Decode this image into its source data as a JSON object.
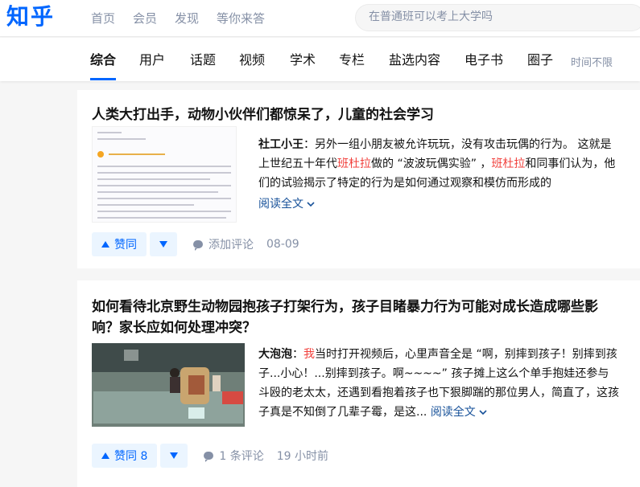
{
  "header": {
    "logo": "知乎",
    "nav": [
      "首页",
      "会员",
      "发现",
      "等你来答"
    ],
    "search_placeholder": "在普通班可以考上大学吗"
  },
  "tabs": {
    "items": [
      "综合",
      "用户",
      "话题",
      "视频",
      "学术",
      "专栏",
      "盐选内容",
      "电子书",
      "圈子"
    ],
    "active": "综合",
    "filter": "时间不限"
  },
  "results": [
    {
      "title": "人类大打出手，动物小伙伴们都惊呆了，儿童的社会学习",
      "author": "社工小王",
      "excerpt_parts": [
        "另外一组小朋友被允许玩玩，没有攻击玩偶的行为。 这就是上世纪五十年代",
        "班杜拉",
        "做的 “波波玩偶实验” ，",
        "班杜拉",
        "和同事们认为，他们的试验揭示了特定的行为是如何通过观察和模仿而形成的"
      ],
      "read_more": "阅读全文",
      "vote_label": "赞同",
      "comment_label": "添加评论",
      "date": "08-09"
    },
    {
      "title": "如何看待北京野生动物园抱孩子打架行为，孩子目睹暴力行为可能对成长造成哪些影响？家长应如何处理冲突？",
      "author": "大泡泡",
      "excerpt_parts": [
        "我",
        "当时打开视频后，心里声音全是 “啊，别摔到孩子！别摔到孩子...小心！...别摔到孩子。啊~~~~” 孩子摊上这么个单手抱娃还参与斗殴的老太太，还遇到看抱着孩子也下狠脚踹的那位男人，简直了，这孩子真是不知倒了几辈子霉，是这..."
      ],
      "read_more": "阅读全文",
      "vote_label": "赞同 8",
      "comment_label": "1 条评论",
      "date": "19 小时前"
    }
  ]
}
